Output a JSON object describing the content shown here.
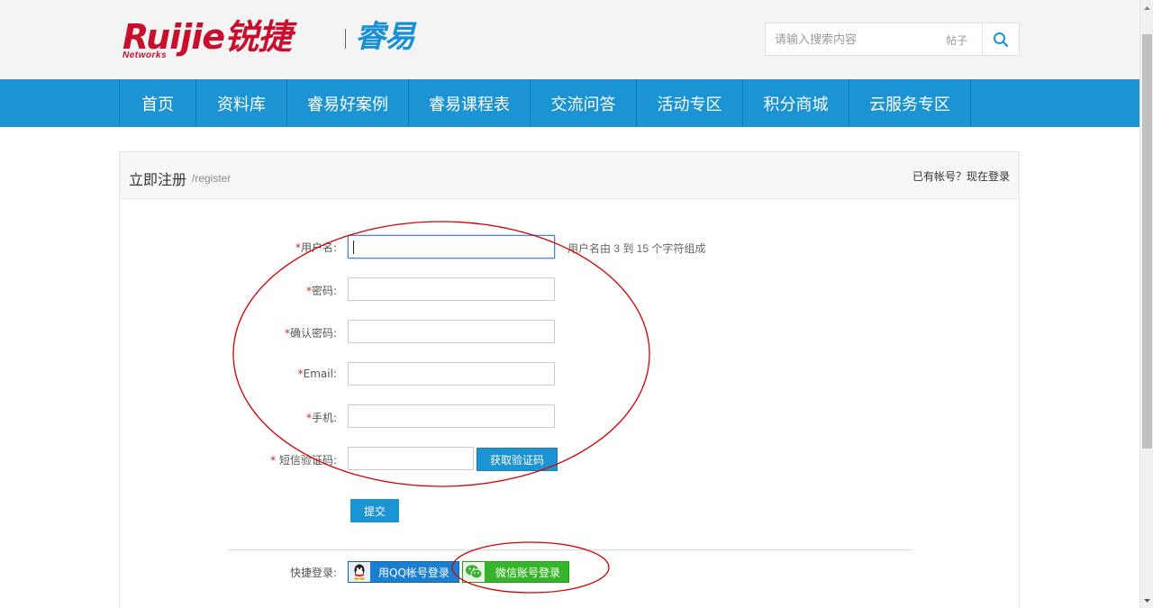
{
  "header": {
    "logo_brand": "Ruijie",
    "logo_cn": "锐捷",
    "logo_sub": "Networks",
    "logo_product": "睿易",
    "search": {
      "placeholder": "请输入搜索内容",
      "scope": "帖子",
      "icon": "search-icon"
    }
  },
  "nav": {
    "items": [
      {
        "label": "首页"
      },
      {
        "label": "资料库"
      },
      {
        "label": "睿易好案例"
      },
      {
        "label": "睿易课程表"
      },
      {
        "label": "交流问答"
      },
      {
        "label": "活动专区"
      },
      {
        "label": "积分商城"
      },
      {
        "label": "云服务专区"
      }
    ]
  },
  "panel": {
    "title": "立即注册",
    "title_en": "/register",
    "login_link": "已有帐号？现在登录"
  },
  "form": {
    "required_mark": "*",
    "username_label": "用户名:",
    "username_hint": "用户名由 3 到 15 个字符组成",
    "password_label": "密码:",
    "confirm_label": "确认密码:",
    "email_label": "Email:",
    "phone_label": "手机:",
    "sms_label": "短信验证码:",
    "get_code_button": "获取验证码",
    "submit_button": "提交"
  },
  "quick_login": {
    "label": "快捷登录:",
    "qq_button": "用QQ帐号登录",
    "wechat_button": "微信账号登录"
  },
  "colors": {
    "nav_blue": "#1c93d3",
    "brand_red": "#c8102e",
    "wechat_green": "#36b52a",
    "qq_blue": "#1a7fd0",
    "annotation_red": "#d40000"
  }
}
